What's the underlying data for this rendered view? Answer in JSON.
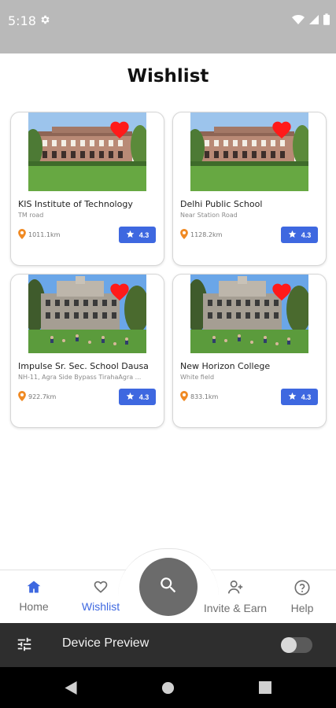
{
  "status_bar": {
    "time": "5:18",
    "icons": [
      "gear-icon",
      "wifi-icon",
      "signal-icon",
      "battery-icon"
    ]
  },
  "page": {
    "title": "Wishlist"
  },
  "wishlist": [
    {
      "name": "KIS Institute of Technology",
      "address": "TM road",
      "distance": "1011.1km",
      "rating": "4.3",
      "image": "campus-building-photo"
    },
    {
      "name": "Delhi Public School",
      "address": "Near Station Road",
      "distance": "1128.2km",
      "rating": "4.3",
      "image": "campus-building-photo"
    },
    {
      "name": "Impulse Sr. Sec. School Dausa",
      "address": "NH-11, Agra Side Bypass TirahaAgra ...",
      "distance": "922.7km",
      "rating": "4.3",
      "image": "college-lawn-photo"
    },
    {
      "name": "New Horizon College",
      "address": "White field",
      "distance": "833.1km",
      "rating": "4.3",
      "image": "college-lawn-photo"
    }
  ],
  "bottom_nav": {
    "items": [
      {
        "label": "Home",
        "icon": "home-icon"
      },
      {
        "label": "Wishlist",
        "icon": "heart-outline-icon",
        "active": true
      },
      {
        "label": "Invite & Earn",
        "icon": "add-person-icon"
      },
      {
        "label": "Help",
        "icon": "help-icon"
      }
    ],
    "center": {
      "icon": "search-icon"
    }
  },
  "device_preview": {
    "label": "Device Preview",
    "enabled": false
  },
  "colors": {
    "accent": "#3e68e0",
    "heart": "#ff1a1a",
    "location_pin": "#f08a24",
    "status_bar": "#b9b9b9",
    "fab": "#6b6b6b"
  }
}
